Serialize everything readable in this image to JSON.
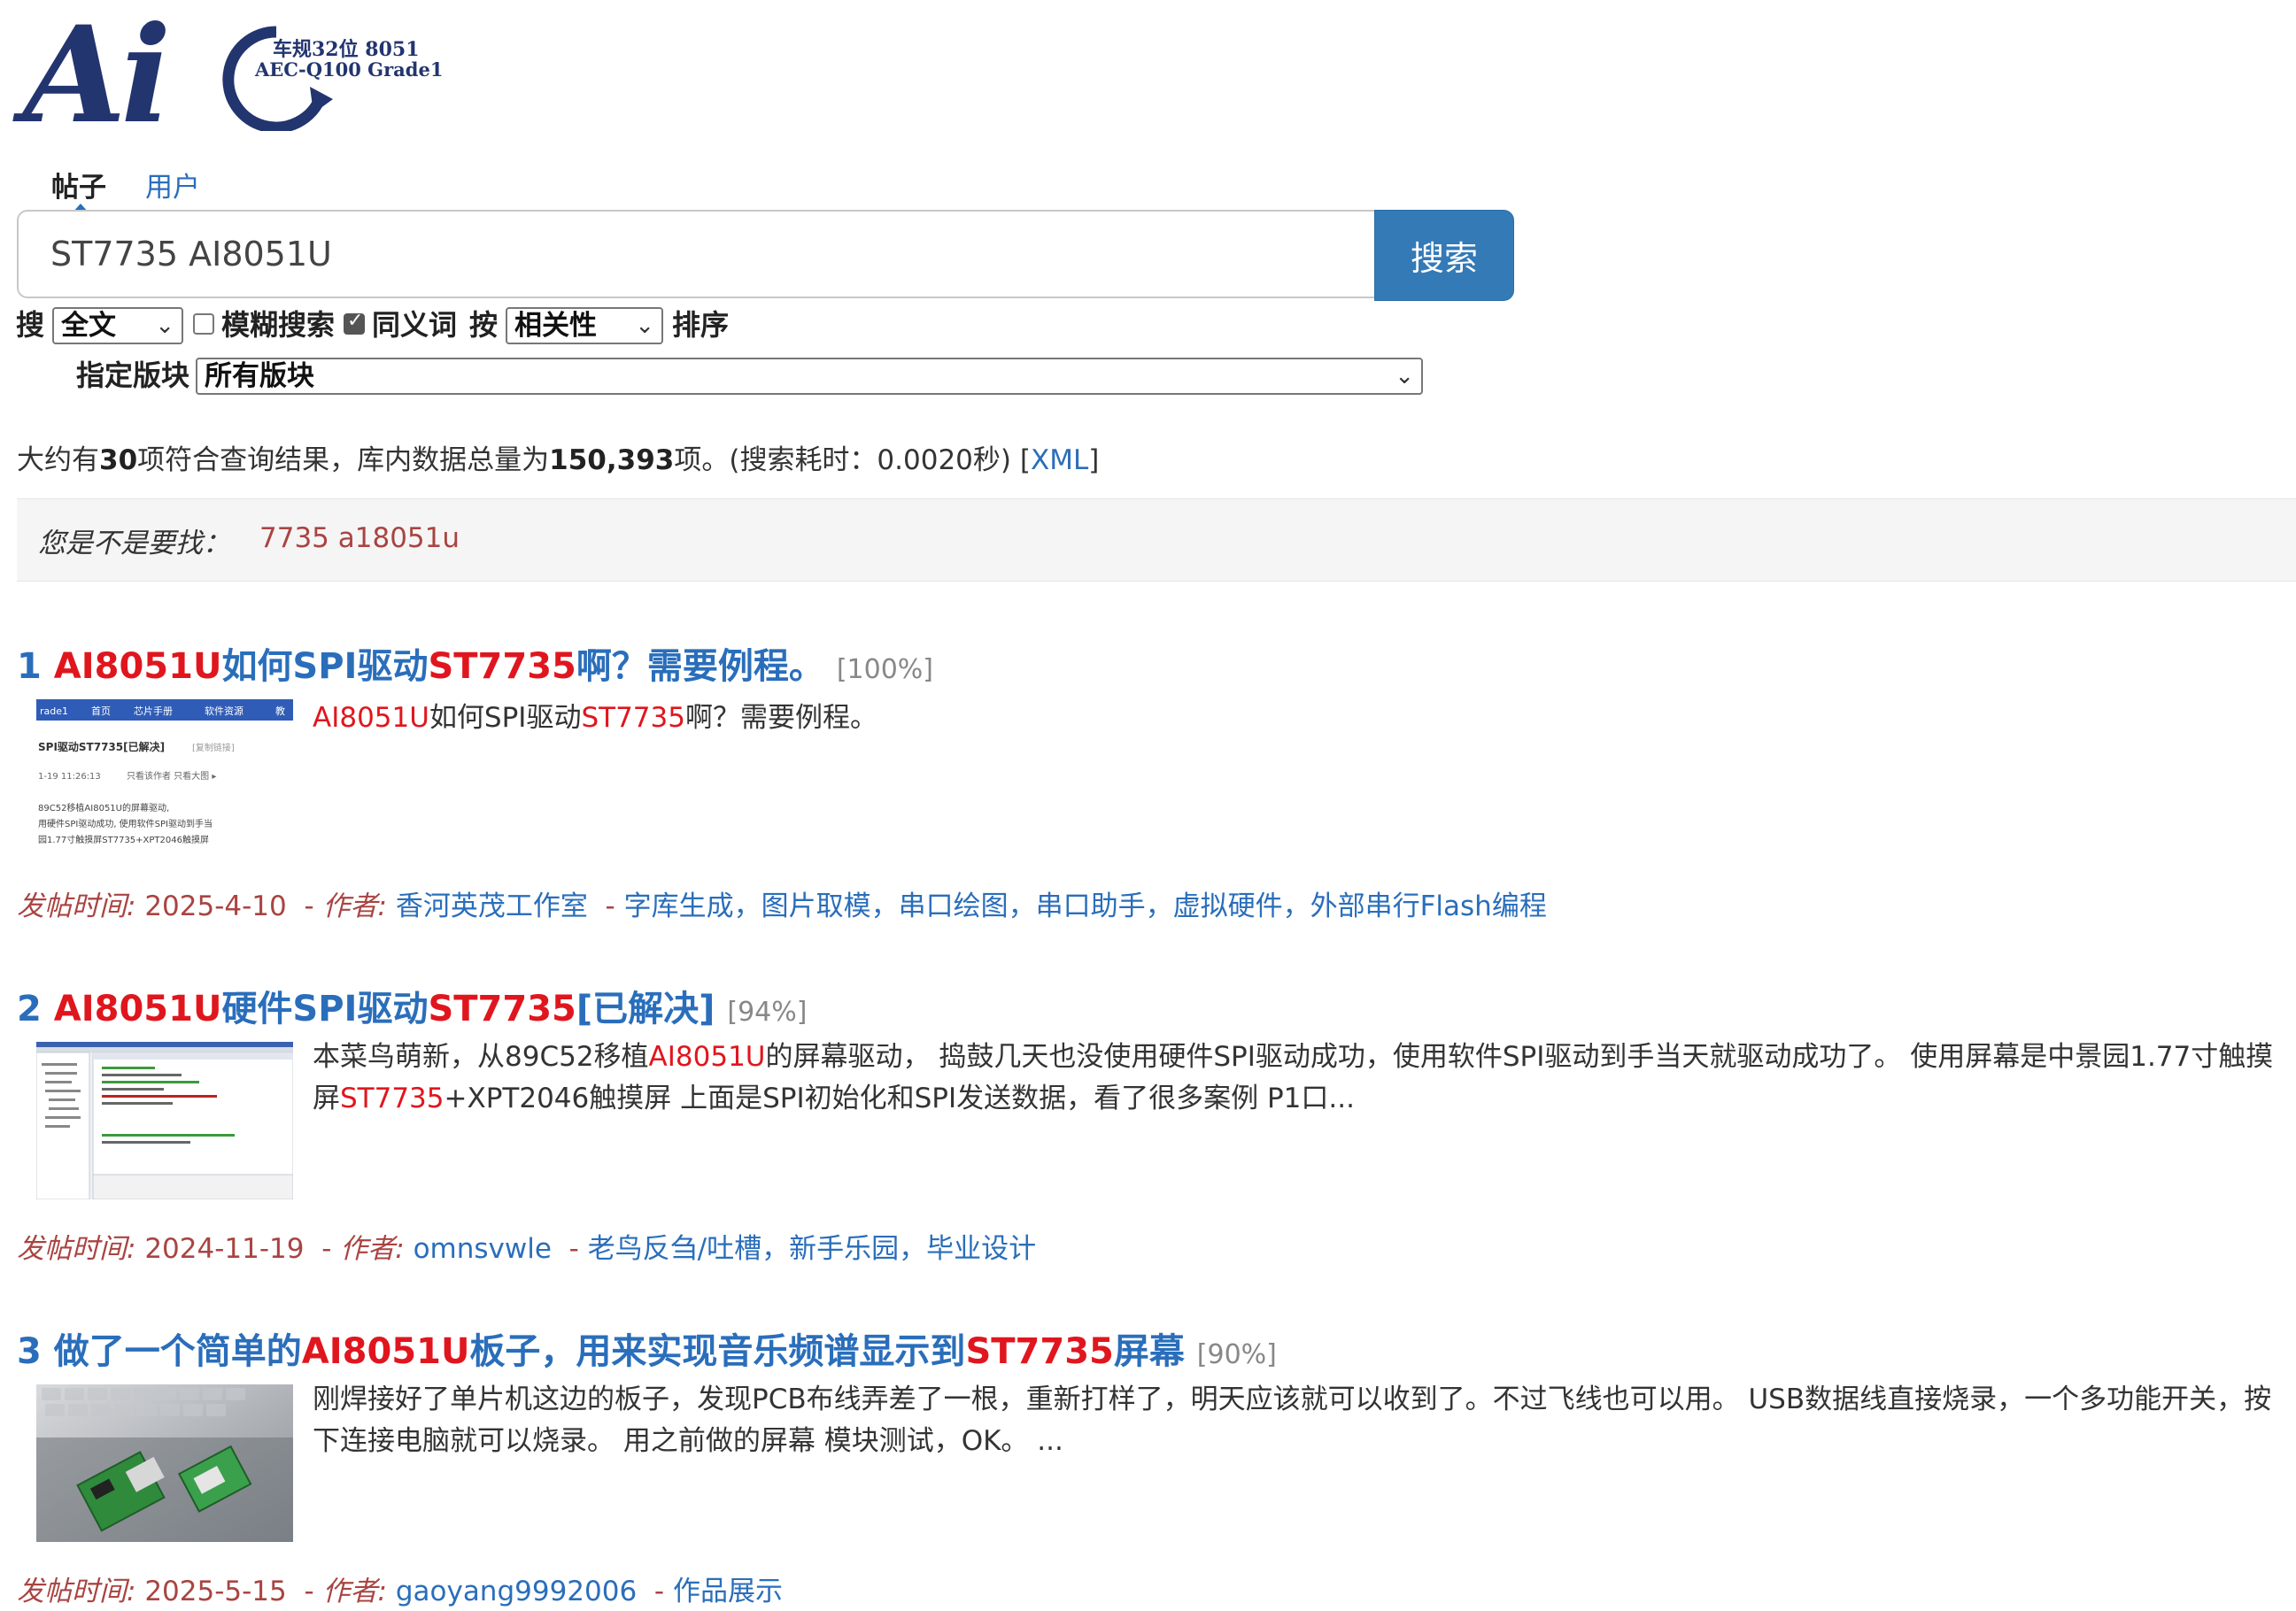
{
  "logo": {
    "text": "Ai",
    "line1": "车规32位 8051",
    "line2": "AEC-Q100 Grade1"
  },
  "tabs": [
    {
      "label": "帖子"
    },
    {
      "label": "用户"
    }
  ],
  "search": {
    "value": "ST7735 AI8051U",
    "button_label": "搜索"
  },
  "options": {
    "search_label": "搜",
    "scope_selected": "全文",
    "fuzzy_label": "模糊搜索",
    "fuzzy_checked": false,
    "synonym_label": "同义词",
    "synonym_checked": true,
    "sort_prefix": "按",
    "sort_selected": "相关性",
    "sort_suffix": "排序",
    "board_label": "指定版块",
    "board_selected": "所有版块"
  },
  "stats": {
    "prefix": "大约有",
    "count": "30",
    "middle": "项符合查询结果，库内数据总量为",
    "total": "150,393",
    "suffix": "项。(搜索耗时：0.0020秒)",
    "xml_open": "[",
    "xml_label": "XML",
    "xml_close": "]"
  },
  "suggestion": {
    "label": "您是不是要找：",
    "link": "7735 a18051u"
  },
  "meta_labels": {
    "posted": "发帖时间:",
    "author": "作者:",
    "sep": "-"
  },
  "results": [
    {
      "index": "1",
      "title_parts": [
        "AI8051U",
        "如何SPI驱动",
        "ST7735",
        "啊？需要例程。"
      ],
      "score": "[100%]",
      "summary_parts": [
        "AI8051U",
        "如何SPI驱动",
        "ST7735",
        "啊？需要例程。"
      ],
      "date": "2025-4-10",
      "author": "香河英茂工作室",
      "tags": "字库生成，图片取模，串口绘图，串口助手，虚拟硬件，外部串行Flash编程"
    },
    {
      "index": "2",
      "title_parts": [
        "AI8051U",
        "硬件SPI驱动",
        "ST7735",
        "[已解决]"
      ],
      "score": "[94%]",
      "summary_parts": [
        "本菜鸟萌新，从89C52移植",
        "AI8051U",
        "的屏幕驱动， 捣鼓几天也没使用硬件SPI驱动成功，使用软件SPI驱动到手当天就驱动成功了。 使用屏幕是中景园1.77寸触摸屏",
        "ST7735",
        "+XPT2046触摸屏 上面是SPI初始化和SPI发送数据，看了很多案例 P1口..."
      ],
      "date": "2024-11-19",
      "author": "omnsvwle",
      "tags": "老鸟反刍/吐槽，新手乐园，毕业设计"
    },
    {
      "index": "3",
      "title_parts": [
        "做了一个简单的",
        "AI8051U",
        "板子，用来实现音乐频谱显示到",
        "ST7735",
        "屏幕"
      ],
      "score": "[90%]",
      "summary": "刚焊接好了单片机这边的板子，发现PCB布线弄差了一根，重新打样了，明天应该就可以收到了。不过飞线也可以用。 USB数据线直接烧录，一个多功能开关，按下连接电脑就可以烧录。 用之前做的屏幕 模块测试，OK。 ...",
      "date": "2025-5-15",
      "author": "gaoyang9992006",
      "tags": "作品展示"
    }
  ],
  "thumb1": {
    "nav": [
      "rade1",
      "首页",
      "芯片手册",
      "软件资源",
      "教"
    ],
    "title": "SPI驱动ST7735[已解决]",
    "tag": "[复制链接]",
    "time": "1-19 11:26:13",
    "viewlinks": "只看该作者  只看大图 ▸",
    "l1": "89C52移植AI8051U的屏幕驱动,",
    "l2": "用硬件SPI驱动成功, 使用软件SPI驱动到手当",
    "l3": "园1.77寸触摸屏ST7735+XPT2046触摸屏"
  },
  "colors": {
    "brand": "#22356f",
    "link": "#2a6ebb",
    "highlight": "#e0161e",
    "meta": "#a94442",
    "button": "#337ab7"
  }
}
